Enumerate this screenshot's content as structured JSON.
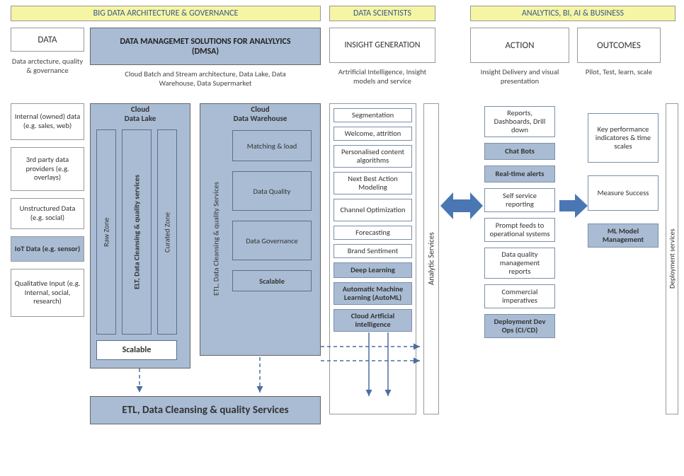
{
  "headers": {
    "bigdata": "BIG DATA ARCHITECTURE & GOVERNANCE",
    "scientists": "DATA SCIENTISTS",
    "analytics": "ANALYTICS, BI, AI & BUSINESS"
  },
  "titles": {
    "data": "DATA",
    "dmsa_line1": "DATA MANAGEMET SOLUTIONS FOR ANALYLYICS",
    "dmsa_line2": "(DMSA)",
    "insight": "INSIGHT GENERATION",
    "action": "ACTION",
    "outcomes": "OUTCOMES"
  },
  "subs": {
    "data": "Data arctecture, quality & governance",
    "dmsa": "Cloud Batch and Stream architecture, Data Lake, Data Warehouse, Data Supermarket",
    "insight": "Artrificial Intelligence, Insight models and service",
    "action": "Insight Delivery and visual presentation",
    "outcomes": "Pilot, Test, learn, scale"
  },
  "data_sources": [
    {
      "label": "Internal (owned) data (e.g. sales, web)",
      "blue": false
    },
    {
      "label": "3rd party data providers (e.g. overlays)",
      "blue": false
    },
    {
      "label": "Unstructured Data (e.g. social)",
      "blue": false
    },
    {
      "label": "IoT Data (e.g. sensor)",
      "blue": true
    },
    {
      "label": "Qualitative Input (e.g. Internal, social, research)",
      "blue": false
    }
  ],
  "cloud_lake": {
    "title": "Cloud\nData Lake",
    "raw": "Raw Zone",
    "elt": "ELT, Data Cleansing & quality services",
    "curated": "Curated Zone",
    "scalable": "Scalable"
  },
  "cloud_wh": {
    "title": "Cloud\nData Warehouse",
    "etl": "ETL, Data Cleansing & quality Services",
    "boxes": [
      "Matching & load",
      "Data Quality",
      "Data Governance",
      "Scalable"
    ]
  },
  "etl_bar": "ETL, Data Cleansing & quality Services",
  "insight_items": [
    {
      "label": "Segmentation",
      "blue": false
    },
    {
      "label": "Welcome, attrition",
      "blue": false
    },
    {
      "label": "Personalised content algorithms",
      "blue": false
    },
    {
      "label": "Next Best Action Modeling",
      "blue": false
    },
    {
      "label": "Channel Optimization",
      "blue": false
    },
    {
      "label": "Forecasting",
      "blue": false
    },
    {
      "label": "Brand Sentiment",
      "blue": false
    },
    {
      "label": "Deep Learning",
      "blue": true
    },
    {
      "label": "Automatic Machine Learning (AutoML)",
      "blue": true
    },
    {
      "label": "Cloud Artficial Intelligence",
      "blue": true
    }
  ],
  "analytic_services": "Analytic Services",
  "action_items": [
    {
      "label": "Reports, Dashboards, Drill down",
      "blue": false
    },
    {
      "label": "Chat Bots",
      "blue": true
    },
    {
      "label": "Real-time alerts",
      "blue": true
    },
    {
      "label": "Self service reporting",
      "blue": false
    },
    {
      "label": "Prompt feeds to operational systems",
      "blue": false
    },
    {
      "label": "Data quality management reports",
      "blue": false
    },
    {
      "label": "Commercial imperatives",
      "blue": false
    },
    {
      "label": "Deployment Dev Ops (CI/CD)",
      "blue": true
    }
  ],
  "outcome_items": [
    {
      "label": "Key performance indicatores & time scales",
      "blue": false
    },
    {
      "label": "Measure Success",
      "blue": false
    },
    {
      "label": "ML Model Management",
      "blue": true
    }
  ],
  "deployment": "Deployment services"
}
